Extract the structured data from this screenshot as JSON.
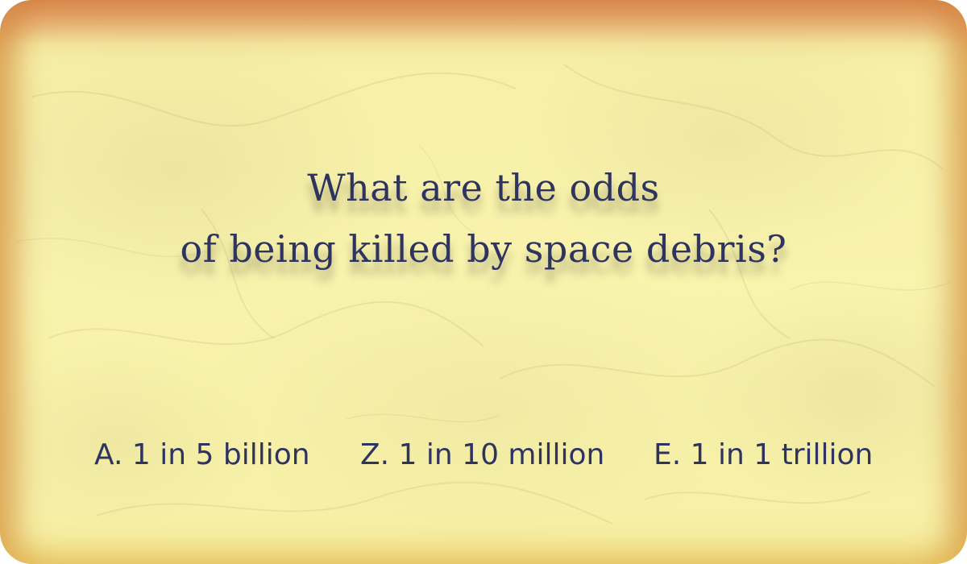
{
  "question": {
    "line1": "What are the odds",
    "line2": "of being killed by space debris?"
  },
  "answers": [
    {
      "label": "A. 1 in 5 billion"
    },
    {
      "label": "Z. 1 in 10 million"
    },
    {
      "label": "E. 1 in 1 trillion"
    }
  ],
  "colors": {
    "text": "#2f3360",
    "parchment": "#f7f0a8",
    "border": "#d68c4a"
  }
}
